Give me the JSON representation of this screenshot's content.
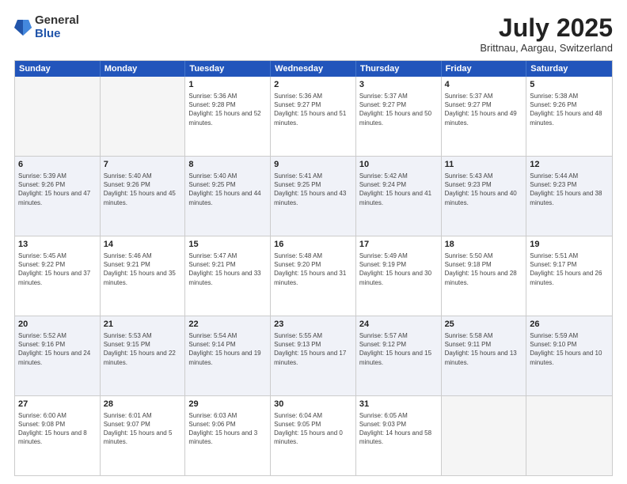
{
  "logo": {
    "general": "General",
    "blue": "Blue"
  },
  "title": "July 2025",
  "subtitle": "Brittnau, Aargau, Switzerland",
  "days_of_week": [
    "Sunday",
    "Monday",
    "Tuesday",
    "Wednesday",
    "Thursday",
    "Friday",
    "Saturday"
  ],
  "weeks": [
    [
      {
        "day": "",
        "empty": true,
        "sunrise": "",
        "sunset": "",
        "daylight": ""
      },
      {
        "day": "",
        "empty": true,
        "sunrise": "",
        "sunset": "",
        "daylight": ""
      },
      {
        "day": "1",
        "empty": false,
        "sunrise": "Sunrise: 5:36 AM",
        "sunset": "Sunset: 9:28 PM",
        "daylight": "Daylight: 15 hours and 52 minutes."
      },
      {
        "day": "2",
        "empty": false,
        "sunrise": "Sunrise: 5:36 AM",
        "sunset": "Sunset: 9:27 PM",
        "daylight": "Daylight: 15 hours and 51 minutes."
      },
      {
        "day": "3",
        "empty": false,
        "sunrise": "Sunrise: 5:37 AM",
        "sunset": "Sunset: 9:27 PM",
        "daylight": "Daylight: 15 hours and 50 minutes."
      },
      {
        "day": "4",
        "empty": false,
        "sunrise": "Sunrise: 5:37 AM",
        "sunset": "Sunset: 9:27 PM",
        "daylight": "Daylight: 15 hours and 49 minutes."
      },
      {
        "day": "5",
        "empty": false,
        "sunrise": "Sunrise: 5:38 AM",
        "sunset": "Sunset: 9:26 PM",
        "daylight": "Daylight: 15 hours and 48 minutes."
      }
    ],
    [
      {
        "day": "6",
        "empty": false,
        "sunrise": "Sunrise: 5:39 AM",
        "sunset": "Sunset: 9:26 PM",
        "daylight": "Daylight: 15 hours and 47 minutes."
      },
      {
        "day": "7",
        "empty": false,
        "sunrise": "Sunrise: 5:40 AM",
        "sunset": "Sunset: 9:26 PM",
        "daylight": "Daylight: 15 hours and 45 minutes."
      },
      {
        "day": "8",
        "empty": false,
        "sunrise": "Sunrise: 5:40 AM",
        "sunset": "Sunset: 9:25 PM",
        "daylight": "Daylight: 15 hours and 44 minutes."
      },
      {
        "day": "9",
        "empty": false,
        "sunrise": "Sunrise: 5:41 AM",
        "sunset": "Sunset: 9:25 PM",
        "daylight": "Daylight: 15 hours and 43 minutes."
      },
      {
        "day": "10",
        "empty": false,
        "sunrise": "Sunrise: 5:42 AM",
        "sunset": "Sunset: 9:24 PM",
        "daylight": "Daylight: 15 hours and 41 minutes."
      },
      {
        "day": "11",
        "empty": false,
        "sunrise": "Sunrise: 5:43 AM",
        "sunset": "Sunset: 9:23 PM",
        "daylight": "Daylight: 15 hours and 40 minutes."
      },
      {
        "day": "12",
        "empty": false,
        "sunrise": "Sunrise: 5:44 AM",
        "sunset": "Sunset: 9:23 PM",
        "daylight": "Daylight: 15 hours and 38 minutes."
      }
    ],
    [
      {
        "day": "13",
        "empty": false,
        "sunrise": "Sunrise: 5:45 AM",
        "sunset": "Sunset: 9:22 PM",
        "daylight": "Daylight: 15 hours and 37 minutes."
      },
      {
        "day": "14",
        "empty": false,
        "sunrise": "Sunrise: 5:46 AM",
        "sunset": "Sunset: 9:21 PM",
        "daylight": "Daylight: 15 hours and 35 minutes."
      },
      {
        "day": "15",
        "empty": false,
        "sunrise": "Sunrise: 5:47 AM",
        "sunset": "Sunset: 9:21 PM",
        "daylight": "Daylight: 15 hours and 33 minutes."
      },
      {
        "day": "16",
        "empty": false,
        "sunrise": "Sunrise: 5:48 AM",
        "sunset": "Sunset: 9:20 PM",
        "daylight": "Daylight: 15 hours and 31 minutes."
      },
      {
        "day": "17",
        "empty": false,
        "sunrise": "Sunrise: 5:49 AM",
        "sunset": "Sunset: 9:19 PM",
        "daylight": "Daylight: 15 hours and 30 minutes."
      },
      {
        "day": "18",
        "empty": false,
        "sunrise": "Sunrise: 5:50 AM",
        "sunset": "Sunset: 9:18 PM",
        "daylight": "Daylight: 15 hours and 28 minutes."
      },
      {
        "day": "19",
        "empty": false,
        "sunrise": "Sunrise: 5:51 AM",
        "sunset": "Sunset: 9:17 PM",
        "daylight": "Daylight: 15 hours and 26 minutes."
      }
    ],
    [
      {
        "day": "20",
        "empty": false,
        "sunrise": "Sunrise: 5:52 AM",
        "sunset": "Sunset: 9:16 PM",
        "daylight": "Daylight: 15 hours and 24 minutes."
      },
      {
        "day": "21",
        "empty": false,
        "sunrise": "Sunrise: 5:53 AM",
        "sunset": "Sunset: 9:15 PM",
        "daylight": "Daylight: 15 hours and 22 minutes."
      },
      {
        "day": "22",
        "empty": false,
        "sunrise": "Sunrise: 5:54 AM",
        "sunset": "Sunset: 9:14 PM",
        "daylight": "Daylight: 15 hours and 19 minutes."
      },
      {
        "day": "23",
        "empty": false,
        "sunrise": "Sunrise: 5:55 AM",
        "sunset": "Sunset: 9:13 PM",
        "daylight": "Daylight: 15 hours and 17 minutes."
      },
      {
        "day": "24",
        "empty": false,
        "sunrise": "Sunrise: 5:57 AM",
        "sunset": "Sunset: 9:12 PM",
        "daylight": "Daylight: 15 hours and 15 minutes."
      },
      {
        "day": "25",
        "empty": false,
        "sunrise": "Sunrise: 5:58 AM",
        "sunset": "Sunset: 9:11 PM",
        "daylight": "Daylight: 15 hours and 13 minutes."
      },
      {
        "day": "26",
        "empty": false,
        "sunrise": "Sunrise: 5:59 AM",
        "sunset": "Sunset: 9:10 PM",
        "daylight": "Daylight: 15 hours and 10 minutes."
      }
    ],
    [
      {
        "day": "27",
        "empty": false,
        "sunrise": "Sunrise: 6:00 AM",
        "sunset": "Sunset: 9:08 PM",
        "daylight": "Daylight: 15 hours and 8 minutes."
      },
      {
        "day": "28",
        "empty": false,
        "sunrise": "Sunrise: 6:01 AM",
        "sunset": "Sunset: 9:07 PM",
        "daylight": "Daylight: 15 hours and 5 minutes."
      },
      {
        "day": "29",
        "empty": false,
        "sunrise": "Sunrise: 6:03 AM",
        "sunset": "Sunset: 9:06 PM",
        "daylight": "Daylight: 15 hours and 3 minutes."
      },
      {
        "day": "30",
        "empty": false,
        "sunrise": "Sunrise: 6:04 AM",
        "sunset": "Sunset: 9:05 PM",
        "daylight": "Daylight: 15 hours and 0 minutes."
      },
      {
        "day": "31",
        "empty": false,
        "sunrise": "Sunrise: 6:05 AM",
        "sunset": "Sunset: 9:03 PM",
        "daylight": "Daylight: 14 hours and 58 minutes."
      },
      {
        "day": "",
        "empty": true,
        "sunrise": "",
        "sunset": "",
        "daylight": ""
      },
      {
        "day": "",
        "empty": true,
        "sunrise": "",
        "sunset": "",
        "daylight": ""
      }
    ]
  ]
}
